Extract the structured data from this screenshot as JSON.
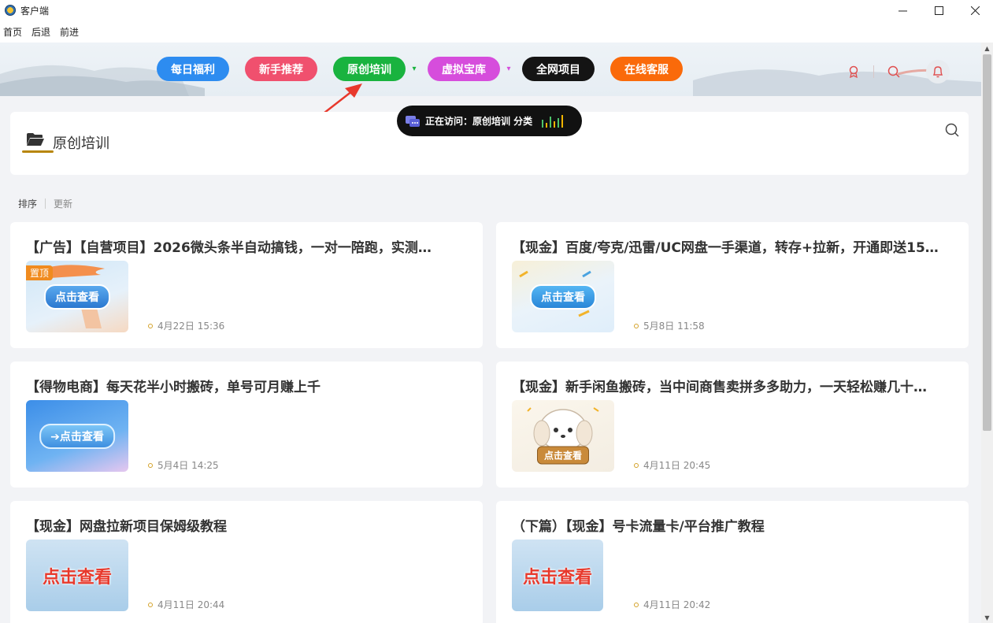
{
  "window": {
    "title": "客户端"
  },
  "menu": {
    "home": "首页",
    "back": "后退",
    "forward": "前进"
  },
  "nav": {
    "items": [
      {
        "label": "每日福利",
        "color": "#2d8cf0"
      },
      {
        "label": "新手推荐",
        "color": "#f0506e"
      },
      {
        "label": "原创培训",
        "color": "#19b33f"
      },
      {
        "label": "虚拟宝库",
        "color": "#d64ddc"
      },
      {
        "label": "全网项目",
        "color": "#141414"
      },
      {
        "label": "在线客服",
        "color": "#fa6a0a"
      }
    ]
  },
  "toast": {
    "text": "正在访问：原创培训 分类"
  },
  "category": {
    "title": "原创培训"
  },
  "sort": {
    "sort_label": "排序",
    "update_label": "更新"
  },
  "posts": [
    {
      "title": "【广告】【自营项目】2026微头条半自动搞钱，一对一陪跑，实测…",
      "thumb_text": "点击查看",
      "pin": "置顶",
      "time": "4月22日 15:36"
    },
    {
      "title": "【现金】百度/夸克/迅雷/UC网盘一手渠道，转存+拉新，开通即送15…",
      "thumb_text": "点击查看",
      "time": "5月8日 11:58"
    },
    {
      "title": "【得物电商】每天花半小时搬砖，单号可月赚上千",
      "thumb_text": "➔点击查看",
      "time": "5月4日 14:25"
    },
    {
      "title": "【现金】新手闲鱼搬砖，当中间商售卖拼多多助力，一天轻松赚几十…",
      "thumb_text": "点击查看",
      "time": "4月11日 20:45"
    },
    {
      "title": "【现金】网盘拉新项目保姆级教程",
      "thumb_text": "点击查看",
      "time": "4月11日 20:44"
    },
    {
      "title": "（下篇）【现金】号卡流量卡/平台推广教程",
      "thumb_text": "点击查看",
      "time": "4月11日 20:42"
    }
  ]
}
